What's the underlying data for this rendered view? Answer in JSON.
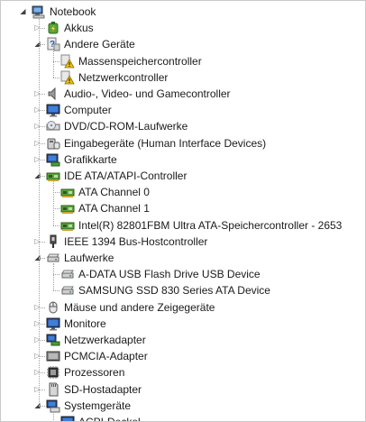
{
  "tree": {
    "root": {
      "label": "Notebook",
      "icon": "computer-icon",
      "expanded": true
    },
    "nodes": [
      {
        "label": "Akkus",
        "icon": "battery-icon",
        "level": 1,
        "expanded": false
      },
      {
        "label": "Andere Geräte",
        "icon": "other-devices-icon",
        "level": 1,
        "expanded": true
      },
      {
        "label": "Massenspeichercontroller",
        "icon": "warning-device-icon",
        "level": 2
      },
      {
        "label": "Netzwerkcontroller",
        "icon": "warning-device-icon",
        "level": 2
      },
      {
        "label": "Audio-, Video- und Gamecontroller",
        "icon": "speaker-icon",
        "level": 1,
        "expanded": false
      },
      {
        "label": "Computer",
        "icon": "monitor-icon",
        "level": 1,
        "expanded": false
      },
      {
        "label": "DVD/CD-ROM-Laufwerke",
        "icon": "optical-drive-icon",
        "level": 1,
        "expanded": false
      },
      {
        "label": "Eingabegeräte (Human Interface Devices)",
        "icon": "hid-icon",
        "level": 1,
        "expanded": false
      },
      {
        "label": "Grafikkarte",
        "icon": "display-adapter-icon",
        "level": 1,
        "expanded": false
      },
      {
        "label": "IDE ATA/ATAPI-Controller",
        "icon": "ide-controller-icon",
        "level": 1,
        "expanded": true
      },
      {
        "label": "ATA Channel 0",
        "icon": "ide-controller-icon",
        "level": 2
      },
      {
        "label": "ATA Channel 1",
        "icon": "ide-controller-icon",
        "level": 2
      },
      {
        "label": "Intel(R) 82801FBM Ultra ATA-Speichercontroller - 2653",
        "icon": "ide-controller-icon",
        "level": 2
      },
      {
        "label": "IEEE 1394 Bus-Hostcontroller",
        "icon": "firewire-icon",
        "level": 1,
        "expanded": false
      },
      {
        "label": "Laufwerke",
        "icon": "disk-drive-icon",
        "level": 1,
        "expanded": true
      },
      {
        "label": "A-DATA USB Flash Drive USB Device",
        "icon": "disk-drive-icon",
        "level": 2
      },
      {
        "label": "SAMSUNG SSD 830 Series ATA Device",
        "icon": "disk-drive-icon",
        "level": 2
      },
      {
        "label": "Mäuse und andere Zeigegeräte",
        "icon": "mouse-icon",
        "level": 1,
        "expanded": false
      },
      {
        "label": "Monitore",
        "icon": "monitor-icon",
        "level": 1,
        "expanded": false
      },
      {
        "label": "Netzwerkadapter",
        "icon": "network-adapter-icon",
        "level": 1,
        "expanded": false
      },
      {
        "label": "PCMCIA-Adapter",
        "icon": "pcmcia-icon",
        "level": 1,
        "expanded": false
      },
      {
        "label": "Prozessoren",
        "icon": "processor-icon",
        "level": 1,
        "expanded": false
      },
      {
        "label": "SD-Hostadapter",
        "icon": "sd-host-icon",
        "level": 1,
        "expanded": false
      },
      {
        "label": "Systemgeräte",
        "icon": "system-device-icon",
        "level": 1,
        "expanded": true
      },
      {
        "label": "ACPI-Deckel",
        "icon": "monitor-icon",
        "level": 2
      }
    ]
  },
  "colors": {
    "tree_line": "#a0a0a0",
    "toggle_collapsed": "#7a7a7a",
    "toggle_expanded": "#404040",
    "warning": "#f2c200"
  }
}
